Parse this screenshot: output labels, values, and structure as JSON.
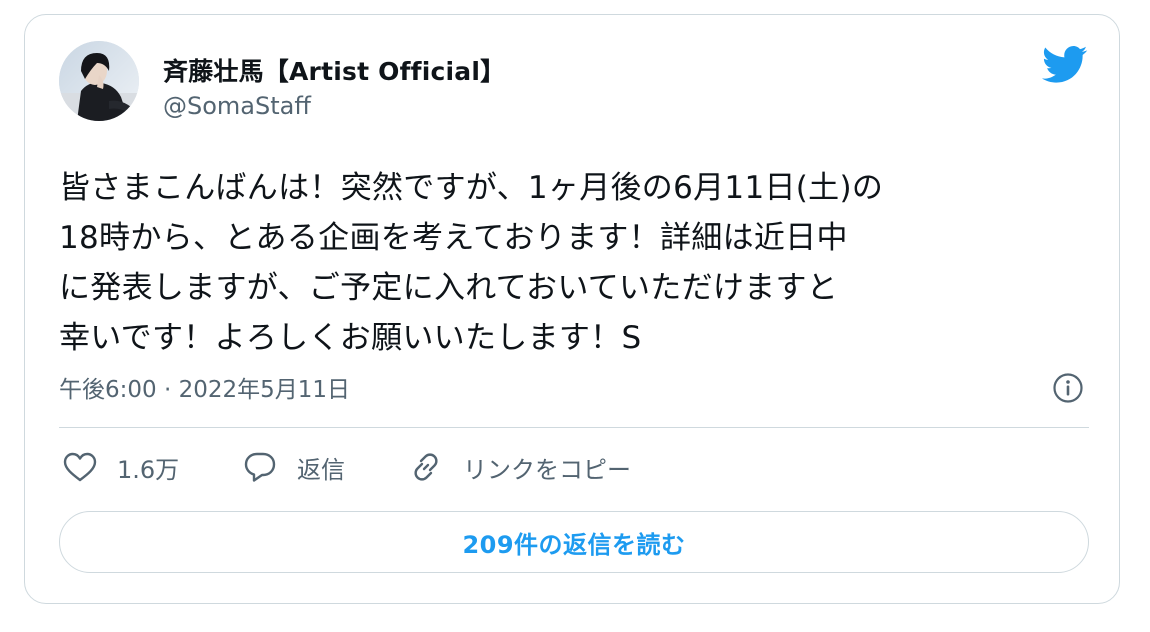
{
  "author": {
    "display_name": "斉藤壮馬【Artist Official】",
    "handle": "@SomaStaff"
  },
  "tweet": {
    "lines": [
      "皆さまこんばんは！突然ですが、1ヶ月後の6月11日(土)の",
      "18時から、とある企画を考えております！詳細は近日中",
      "に発表しますが、ご予定に入れておいていただけますと",
      "幸いです！よろしくお願いいたします！S"
    ],
    "timestamp": "午後6:00 · 2022年5月11日"
  },
  "actions": {
    "like_count": "1.6万",
    "reply_label": "返信",
    "copy_link_label": "リンクをコピー"
  },
  "read_replies_label": "209件の返信を読む",
  "icons": {
    "brand": "twitter-bird-icon",
    "info": "info-icon",
    "like": "heart-icon",
    "reply": "speech-bubble-icon",
    "link": "link-icon"
  },
  "colors": {
    "brand": "#1d9bf0",
    "text": "#0f1419",
    "secondary": "#536471",
    "border": "#cfd9de"
  }
}
